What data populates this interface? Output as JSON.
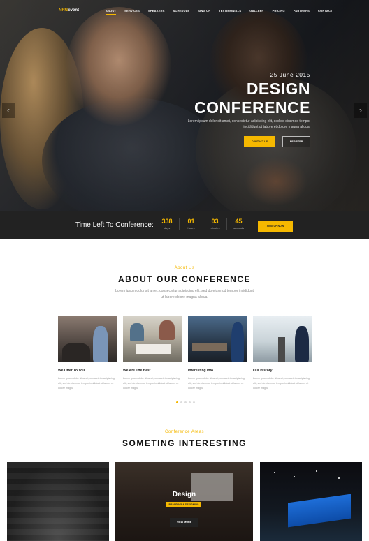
{
  "nav": {
    "logo_main": "NRG",
    "logo_rest": "event",
    "items": [
      "ABOUT",
      "SERVICES",
      "SPEAKERS",
      "SCHEDULE",
      "SING UP",
      "TESTIMONIALS",
      "GALLERY",
      "PRICING",
      "PARTNERS",
      "CONTACT"
    ]
  },
  "hero": {
    "date": "25 June 2015",
    "title_line1": "DESIGN",
    "title_line2": "CONFERENCE",
    "description": "Lorem ipsum dolor sit amet, consectetur adipiscing elit, sed do eiusmod tempor incididunt ut labore et dolore magna aliqua.",
    "btn_contact": "CONTACT US",
    "btn_register": "REGISTER",
    "prev_arrow": "‹",
    "next_arrow": "›"
  },
  "countdown": {
    "title": "Time Left To Conference:",
    "units": [
      {
        "num": "338",
        "label": "days"
      },
      {
        "num": "01",
        "label": "hours"
      },
      {
        "num": "03",
        "label": "minutes"
      },
      {
        "num": "45",
        "label": "seconds"
      }
    ],
    "button": "SING UP NOW"
  },
  "about": {
    "subtitle": "About Us",
    "title": "ABOUT OUR CONFERENCE",
    "description": "Lorem ipsum dolor sit amet, consectetur adipiscing elit, sed do eiusmod tempor incididunt ut labore dolore magna aliqua.",
    "cards": [
      {
        "title": "We Offer To You",
        "text": "Lorem ipsum dolor sit amet, consectetur adipiscing elit, sed do eiusmod tempor incididunt ut labore et dolore magna"
      },
      {
        "title": "We Are The Best",
        "text": "Lorem ipsum dolor sit amet, consectetur adipiscing elit, sed do eiusmod tempor incididunt ut labore et dolore magna"
      },
      {
        "title": "Interesting Info",
        "text": "Lorem ipsum dolor sit amet, consectetur adipiscing elit, sed do eiusmod tempor incididunt ut labore et dolore magna"
      },
      {
        "title": "Our History",
        "text": "Lorem ipsum dolor sit amet, consectetur adipiscing elit, sed do eiusmod tempor incididunt ut labore et dolore magna"
      }
    ]
  },
  "areas": {
    "subtitle": "Conference Areas",
    "title": "SOMETING INTERESTING",
    "tile_title": "Design",
    "tile_tag": "BRANDING & DESIGNING",
    "tile_button": "VIEW MORE"
  },
  "colors": {
    "accent": "#f5b800",
    "dark": "#222222"
  }
}
